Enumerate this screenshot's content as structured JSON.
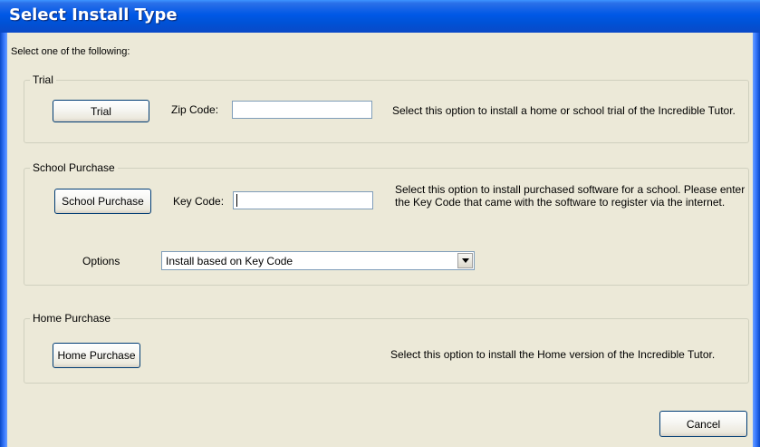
{
  "window": {
    "title": "Select Install Type"
  },
  "prompt": "Select one of the following:",
  "trial": {
    "group_label": "Trial",
    "button_label": "Trial",
    "zip_label": "Zip Code:",
    "zip_value": "",
    "description": "Select this option to install a home or school trial of the Incredible Tutor."
  },
  "school": {
    "group_label": "School Purchase",
    "button_label": "School Purchase",
    "key_label": "Key Code:",
    "key_value": "",
    "description_line1": "Select this option to install purchased software for a school. Please enter",
    "description_line2": "the Key Code that came with the software to register via the internet.",
    "options_label": "Options",
    "options_selected": "Install based on Key Code"
  },
  "home": {
    "group_label": "Home Purchase",
    "button_label": "Home Purchase",
    "description": "Select this option to install the Home version of the Incredible Tutor."
  },
  "footer": {
    "cancel_label": "Cancel"
  },
  "colors": {
    "title_bar": "#0058e6",
    "face": "#ece9d8",
    "button_border": "#003c74"
  }
}
